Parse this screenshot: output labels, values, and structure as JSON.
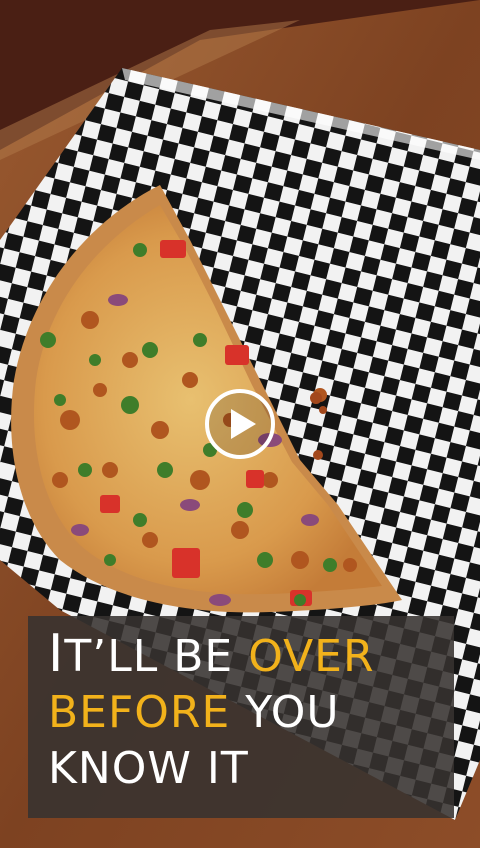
{
  "image": {
    "subject": "pizza-slice-on-checkered-paper",
    "colors": {
      "table_wood": "#8a4a26",
      "wall": "#4a1f14",
      "checker_dark": "#141414",
      "checker_light": "#f2f2f2",
      "crust": "#c98a4a",
      "cheese": "#e2b863",
      "highlight_text": "#f2b21b",
      "caption_bg": "#373230"
    }
  },
  "player": {
    "play_icon": "play-icon"
  },
  "caption": {
    "line1_first_letter": "I",
    "line1_rest": "t’ll be ",
    "line1_highlight": "OVER",
    "line2_highlight": "BEFORE",
    "line2_rest": " YOU",
    "line3": "KNOW IT"
  }
}
